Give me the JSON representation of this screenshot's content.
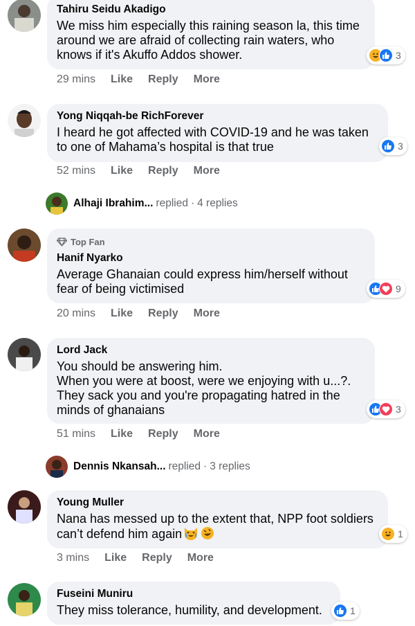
{
  "comments": [
    {
      "author": "Tahiru Seidu Akadigo",
      "text": "We miss him especially this raining season la, this time around we are afraid of collecting rain waters, who knows if it's Akuffo Addos shower.",
      "reaction_count": "3",
      "reactions": [
        "haha",
        "like"
      ],
      "time": "29 mins"
    },
    {
      "author": "Yong Niqqah-be RichForever",
      "text": "I heard he got affected with COVID-19 and he was taken to one of Mahama’s hospital is that true",
      "reaction_count": "3",
      "reactions": [
        "like"
      ],
      "time": "52 mins"
    },
    {
      "badge": "Top Fan",
      "author": "Hanif Nyarko",
      "text": "Average Ghanaian could express him/herself without fear of being victimised",
      "reaction_count": "9",
      "reactions": [
        "like",
        "love"
      ],
      "time": "20 mins"
    },
    {
      "author": "Lord Jack",
      "text": "You should be answering him.\nWhen you were at boost, were we enjoying with u...?.\nThey sack you and you're propagating hatred in the minds of ghanaians",
      "reaction_count": "3",
      "reactions": [
        "like",
        "love"
      ],
      "time": "51 mins"
    },
    {
      "author": "Young Muller",
      "text": "Nana has messed up to the extent that, NPP foot soldiers can’t defend him again",
      "reaction_count": "1",
      "reactions": [
        "haha"
      ],
      "time": "3 mins"
    },
    {
      "author": "Fuseini Muniru",
      "text": "They miss tolerance, humility, and development.",
      "reaction_count": "1",
      "reactions": [
        "like"
      ],
      "time": ""
    }
  ],
  "replies": [
    {
      "name": "Alhaji Ibrahim...",
      "verb": "replied",
      "sep": "·",
      "count": "4 replies"
    },
    {
      "name": "Dennis Nkansah...",
      "verb": "replied",
      "sep": "·",
      "count": "3 replies"
    }
  ],
  "actions": {
    "like": "Like",
    "reply": "Reply",
    "more": "More"
  },
  "colors": {
    "bubble": "#f0f2f5",
    "meta": "#65676b",
    "like_blue": "#1877f2",
    "love_red": "#f33e58",
    "haha_yellow": "#f7b125"
  }
}
